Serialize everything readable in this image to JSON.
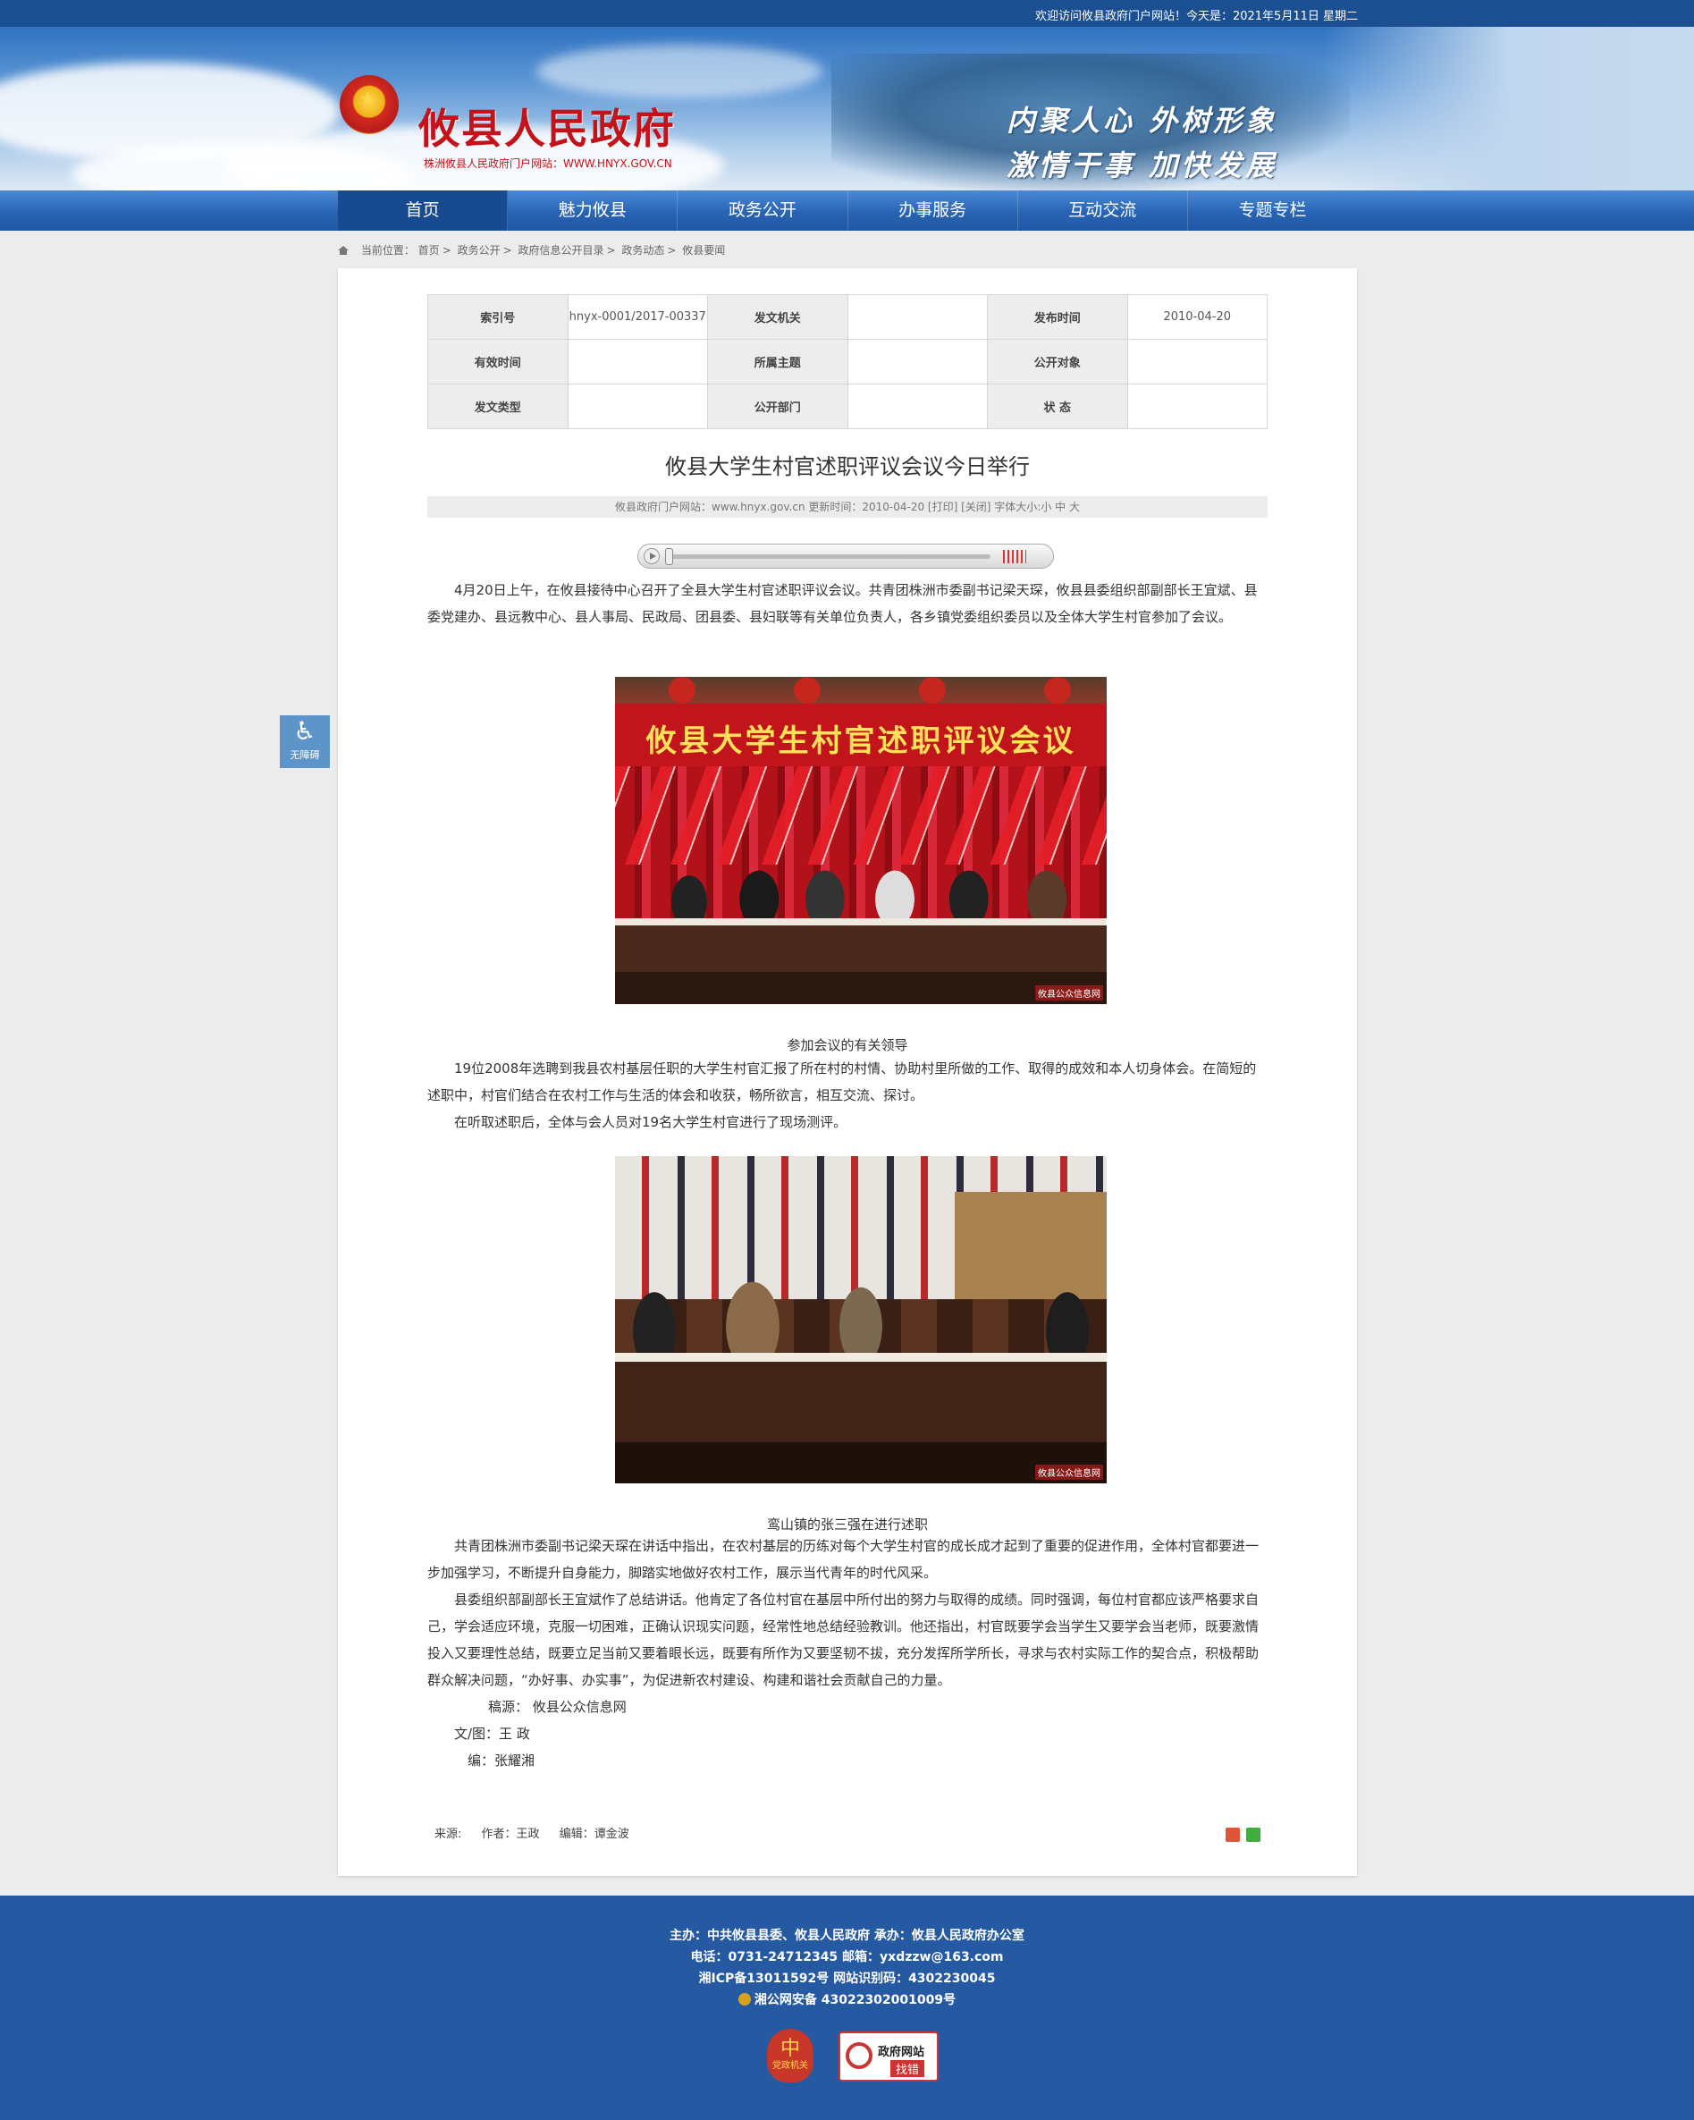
{
  "topbar": {
    "welcome": "欢迎访问攸县政府门户网站！今天是：2021年5月11日 星期二"
  },
  "header": {
    "site_title": "攸县人民政府",
    "site_subtitle": "株洲攸县人民政府门户网站：WWW.HNYX.GOV.CN",
    "slogan_line1": "内聚人心  外树形象",
    "slogan_line2": "激情干事  加快发展"
  },
  "nav": {
    "items": [
      "首页",
      "魅力攸县",
      "政务公开",
      "办事服务",
      "互动交流",
      "专题专栏"
    ],
    "active": "首页"
  },
  "breadcrumb": {
    "label": "当前位置：",
    "items": [
      "首页",
      "政务公开",
      "政府信息公开目录",
      "政务动态",
      "攸县要闻"
    ]
  },
  "accessibility": {
    "label": "无障碍"
  },
  "meta_table": {
    "rows": [
      [
        {
          "k": "索引号",
          "v": "hnyx-0001/2017-00337"
        },
        {
          "k": "发文机关",
          "v": ""
        },
        {
          "k": "发布时间",
          "v": "2010-04-20"
        }
      ],
      [
        {
          "k": "有效时间",
          "v": ""
        },
        {
          "k": "所属主题",
          "v": ""
        },
        {
          "k": "公开对象",
          "v": ""
        }
      ],
      [
        {
          "k": "发文类型",
          "v": ""
        },
        {
          "k": "公开部门",
          "v": ""
        },
        {
          "k": "状 态",
          "v": ""
        }
      ]
    ]
  },
  "article": {
    "title": "攸县大学生村官述职评议会议今日举行",
    "infobar": "攸县政府门户网站：www.hnyx.gov.cn  更新时间：2010-04-20  [打印] [关闭]  字体大小:小 中 大",
    "para1": "4月20日上午，在攸县接待中心召开了全县大学生村官述职评议会议。共青团株洲市委副书记梁天琛，攸县县委组织部副部长王宜斌、县委党建办、县远教中心、县人事局、民政局、团县委、县妇联等有关单位负责人，各乡镇党委组织委员以及全体大学生村官参加了会议。",
    "photo1_banner": "攸县大学生村官述职评议会议",
    "photo_watermark": "攸县公众信息网",
    "caption1": "参加会议的有关领导",
    "para2": "19位2008年选聘到我县农村基层任职的大学生村官汇报了所在村的村情、协助村里所做的工作、取得的成效和本人切身体会。在简短的述职中，村官们结合在农村工作与生活的体会和收获，畅所欲言，相互交流、探讨。",
    "para3": "在听取述职后，全体与会人员对19名大学生村官进行了现场测评。",
    "caption2": "鸾山镇的张三强在进行述职",
    "para4": "共青团株洲市委副书记梁天琛在讲话中指出，在农村基层的历练对每个大学生村官的成长成才起到了重要的促进作用，全体村官都要进一步加强学习，不断提升自身能力，脚踏实地做好农村工作，展示当代青年的时代风采。",
    "para5": "县委组织部副部长王宜斌作了总结讲话。他肯定了各位村官在基层中所付出的努力与取得的成绩。同时强调，每位村官都应该严格要求自己，学会适应环境，克服一切困难，正确认识现实问题，经常性地总结经验教训。他还指出，村官既要学会当学生又要学会当老师，既要激情投入又要理性总结，既要立足当前又要着眼长远，既要有所作为又要坚韧不拔，充分发挥所学所长，寻求与农村实际工作的契合点，积极帮助群众解决问题，“办好事、办实事”，为促进新农村建设、构建和谐社会贡献自己的力量。",
    "source_line": "稿源：  攸县公众信息网",
    "author_line": "文/图：王   政",
    "editor_line": "编：张耀湘"
  },
  "article_footer": {
    "source": "来源:",
    "author": "作者：王政",
    "editor": "编辑：谭金波"
  },
  "footer": {
    "line1": "主办：中共攸县县委、攸县人民政府 承办：攸县人民政府办公室",
    "line2": "电话：0731-24712345 邮箱：yxdzzw@163.com",
    "line3": "湘ICP备13011592号    网站识别码：4302230045",
    "line4": "湘公网安备 43022302001009号",
    "badge1_big": "中",
    "badge1_small": "党政机关",
    "badge2_line1": "政府网站",
    "badge2_line2": "找错"
  },
  "colors": {
    "nav_blue": "#2864b4",
    "footer_blue": "#255aa2",
    "title_red": "#c4121a"
  }
}
